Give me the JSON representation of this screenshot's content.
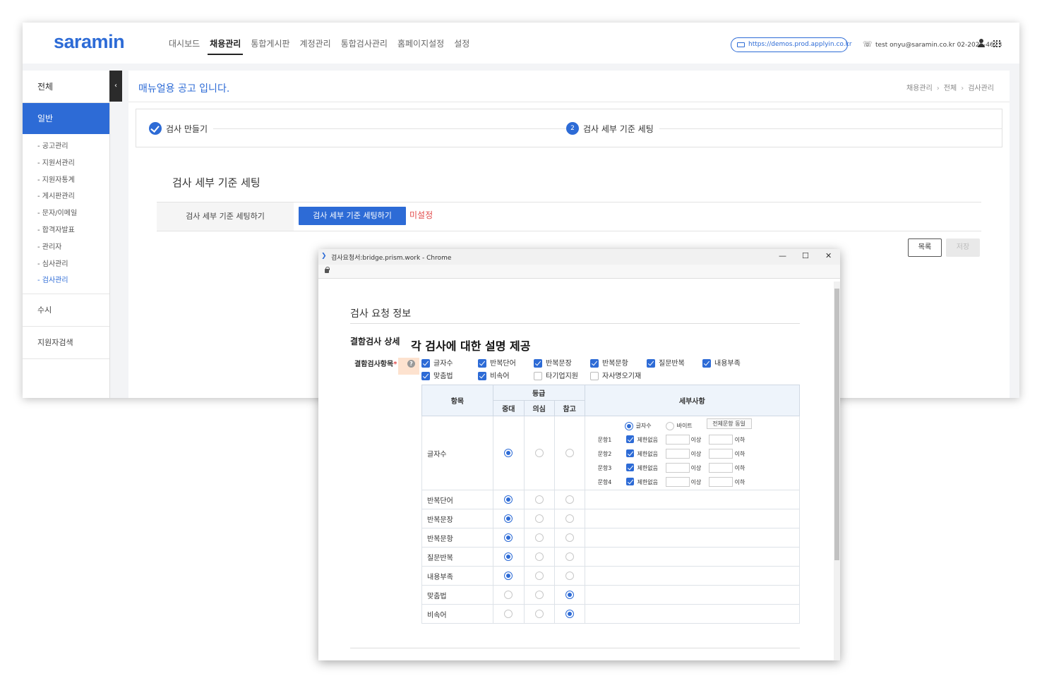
{
  "app": {
    "logo": "saramin",
    "nav": [
      "대시보드",
      "채용관리",
      "통합게시판",
      "계정관리",
      "통합검사관리",
      "홈페이지설정",
      "설정"
    ],
    "nav_active": "채용관리",
    "url": "https://demos.prod.applyin.co.kr",
    "contact": "test onyu@saramin.co.kr 02-2025-4623"
  },
  "sidebar": {
    "title": "전체",
    "group": "일반",
    "sub_items": [
      "- 공고관리",
      "- 지원서관리",
      "- 지원자통계",
      "- 게시판관리",
      "- 문자/이메일",
      "- 합격자발표",
      "- 관리자",
      "- 심사관리",
      "- 검사관리"
    ],
    "active_sub": "- 검사관리",
    "items": [
      "수시",
      "지원자검색"
    ],
    "collapse": "‹"
  },
  "content": {
    "page_title": "매뉴얼용 공고 입니다.",
    "breadcrumb": [
      "채용관리",
      "전체",
      "검사관리"
    ],
    "steps": [
      {
        "label": "검사 만들기",
        "state": "done"
      },
      {
        "num": "2",
        "label": "검사 세부 기준 세팅",
        "state": "current"
      }
    ],
    "section_title": "검사 세부 기준 세팅",
    "setting_label": "검사 세부 기준 세팅하기",
    "setting_button": "검사 세부 기준 세팅하기",
    "setting_status": "미설정",
    "btn_list": "목록",
    "btn_save": "저장"
  },
  "popup": {
    "window_title": "검사요청서:bridge.prism.work - Chrome",
    "controls": [
      "—",
      "☐",
      "✕"
    ],
    "req_title": "검사 요청 정보",
    "combo_title": "결함검사 상세",
    "annotation": "각 검사에 대한 설명 제공",
    "combo_label": "결함검사항목",
    "required_mark": "*",
    "help": "?",
    "checkbox_items": [
      {
        "label": "글자수",
        "checked": true
      },
      {
        "label": "반복단어",
        "checked": true
      },
      {
        "label": "반복문장",
        "checked": true
      },
      {
        "label": "반복문항",
        "checked": true
      },
      {
        "label": "질문반복",
        "checked": true
      },
      {
        "label": "내용부족",
        "checked": true
      },
      {
        "label": "맞춤법",
        "checked": true
      },
      {
        "label": "비속어",
        "checked": true
      },
      {
        "label": "타기업지원",
        "checked": false
      },
      {
        "label": "자사명오기재",
        "checked": false
      }
    ],
    "table": {
      "col_item": "항목",
      "col_grade": "등급",
      "grades": [
        "중대",
        "의심",
        "참고"
      ],
      "col_detail": "세부사항",
      "rows": [
        {
          "name": "글자수",
          "grade": 0
        },
        {
          "name": "반복단어",
          "grade": 0
        },
        {
          "name": "반복문장",
          "grade": 0
        },
        {
          "name": "반복문항",
          "grade": 0
        },
        {
          "name": "질문반복",
          "grade": 0
        },
        {
          "name": "내용부족",
          "grade": 0
        },
        {
          "name": "맞춤법",
          "grade": 2
        },
        {
          "name": "비속어",
          "grade": 2
        }
      ]
    },
    "detail": {
      "unit_char": "글자수",
      "unit_byte": "바이트",
      "same_btn": "전체문항 동일",
      "questions": [
        "문항1",
        "문항2",
        "문항3",
        "문항4"
      ],
      "unlimited": "제한없음",
      "min": "이상",
      "max": "이하"
    }
  }
}
